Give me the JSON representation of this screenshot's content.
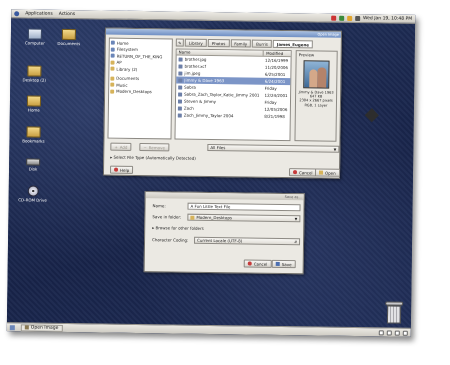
{
  "top_panel": {
    "applications": "Applications",
    "actions": "Actions",
    "clock": "Wed Jan 19, 10:48 PM"
  },
  "bottom_panel": {
    "taskbar_item": "Open Image"
  },
  "desktop": {
    "icons": [
      {
        "label": "Computer",
        "kind": "computer"
      },
      {
        "label": "Documents",
        "kind": "folder"
      },
      {
        "label": "Desktop (2)",
        "kind": "folder"
      },
      {
        "label": "Home",
        "kind": "folder"
      },
      {
        "label": "Bookmarks",
        "kind": "folder"
      },
      {
        "label": "Disk",
        "kind": "drive"
      },
      {
        "label": "CD-ROM Drive",
        "kind": "cd"
      }
    ]
  },
  "open_dialog": {
    "title": "Open Image",
    "places": [
      {
        "label": "Home",
        "kind": "home"
      },
      {
        "label": "Filesystem",
        "kind": "disk"
      },
      {
        "label": "RETURN_OF_THE_KING",
        "kind": "disk"
      },
      {
        "label": "AP",
        "kind": "folder"
      },
      {
        "label": "Library (2)",
        "kind": "folder"
      },
      {
        "label": "Documents",
        "kind": "folder"
      },
      {
        "label": "Music",
        "kind": "folder"
      },
      {
        "label": "Modern_Desktops",
        "kind": "folder"
      }
    ],
    "path": [
      "Library",
      "Photos",
      "Family",
      "Burris",
      "James_Eugene"
    ],
    "columns": {
      "name": "Name",
      "modified": "Modified"
    },
    "files": [
      {
        "name": "brother.jpg",
        "modified": "12/16/1999",
        "selected": false
      },
      {
        "name": "brother.xcf",
        "modified": "11/20/2006",
        "selected": false
      },
      {
        "name": "jim.jpeg",
        "modified": "6/25/2001",
        "selected": false
      },
      {
        "name": "Jimmy & Dave 1963",
        "modified": "6/24/2001",
        "selected": true
      },
      {
        "name": "Sabra",
        "modified": "Friday",
        "selected": false
      },
      {
        "name": "Sabra_Zach_Taylor_Katie_Jimmy 2001",
        "modified": "12/24/2001",
        "selected": false
      },
      {
        "name": "Steven & Jimmy",
        "modified": "Friday",
        "selected": false
      },
      {
        "name": "Zach",
        "modified": "12/05/2006",
        "selected": false
      },
      {
        "name": "Zach_Jimmy_Taylor 2004",
        "modified": "8/21/1998",
        "selected": false
      }
    ],
    "preview": {
      "header": "Preview",
      "caption": "Jimmy & Dave 1963",
      "size": "647 KB",
      "dimensions": "2304 x 2667 pixels",
      "mode": "RGB, 1 Layer"
    },
    "add_label": "Add",
    "remove_label": "Remove",
    "filter": "All Files",
    "file_type_label": "Select File Type (Automatically Detected)",
    "help_label": "Help",
    "cancel_label": "Cancel",
    "open_label": "Open"
  },
  "save_dialog": {
    "title": "Save as...",
    "name_label": "Name:",
    "name_value": "A Fun Little Text File",
    "folder_label": "Save in folder:",
    "folder_value": "Modern_Desktops",
    "browse_label": "Browse for other folders",
    "encoding_label": "Character Coding:",
    "encoding_value": "Current Locale (UTF-8)",
    "cancel_label": "Cancel",
    "save_label": "Save"
  },
  "colors": {
    "desktop": "#1d2c55",
    "selection": "#7c95c7",
    "titlebar_active": "#6f8fc4"
  }
}
